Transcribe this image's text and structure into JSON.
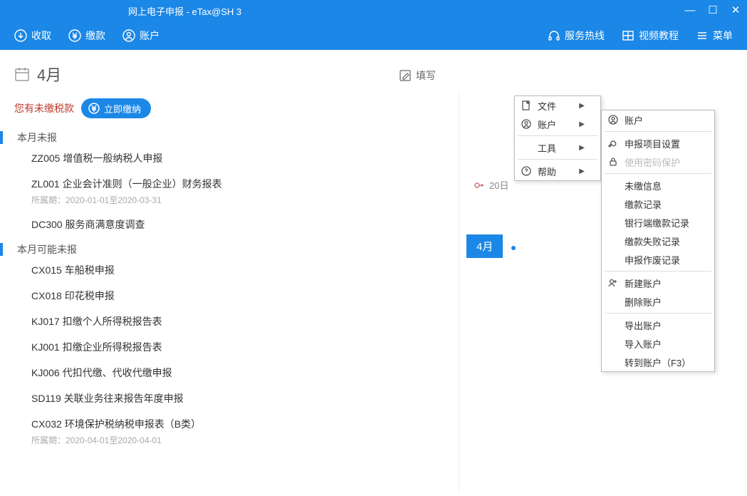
{
  "window": {
    "title": "网上电子申报 - eTax@SH 3"
  },
  "toolbar": {
    "collect": "收取",
    "pay": "缴款",
    "account": "账户",
    "hotline": "服务热线",
    "video": "视频教程",
    "menu": "菜单"
  },
  "page": {
    "month": "4月",
    "edit": "填写",
    "notice": "您有未缴税款",
    "pay_now": "立即缴纳",
    "section1": "本月未报",
    "items1": [
      {
        "name": "ZZ005 增值税一般纳税人申报",
        "period": ""
      },
      {
        "name": "ZL001 企业会计准则（一般企业）财务报表",
        "period": "所属期：2020-01-01至2020-03-31"
      },
      {
        "name": "DC300 服务商满意度调查",
        "period": ""
      }
    ],
    "section2": "本月可能未报",
    "items2": [
      {
        "name": "CX015 车船税申报",
        "period": ""
      },
      {
        "name": "CX018 印花税申报",
        "period": ""
      },
      {
        "name": "KJ017 扣缴个人所得税报告表",
        "period": ""
      },
      {
        "name": "KJ001 扣缴企业所得税报告表",
        "period": ""
      },
      {
        "name": "KJ006 代扣代缴、代收代缴申报",
        "period": ""
      },
      {
        "name": "SD119 关联业务往来报告年度申报",
        "period": ""
      },
      {
        "name": "CX032 环境保护税纳税申报表（B类）",
        "period": "所属期：2020-04-01至2020-04-01"
      }
    ]
  },
  "side": {
    "due": "20日",
    "month": "4月"
  },
  "menu1": {
    "file": "文件",
    "account": "账户",
    "tools": "工具",
    "help": "帮助"
  },
  "menu2": {
    "account": "账户",
    "proj_settings": "申报项目设置",
    "pwd_protect": "使用密码保护",
    "unpaid_info": "未缴信息",
    "pay_records": "缴款记录",
    "bank_records": "银行端缴款记录",
    "fail_records": "缴款失败记录",
    "void_records": "申报作废记录",
    "new_account": "新建账户",
    "del_account": "删除账户",
    "export_account": "导出账户",
    "import_account": "导入账户",
    "switch_account": "转到账户（F3）"
  }
}
